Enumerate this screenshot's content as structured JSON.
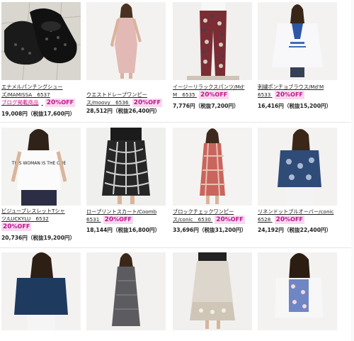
{
  "discount_suffix": "%OFF",
  "colors": {
    "accent": "#c0148c",
    "badge_bg": "#f7d9ef"
  },
  "products": [
    {
      "name_line1": "エナメルパンチングシュー",
      "name_line2": "ズ/MAMISSA　6537",
      "extra_tag": "ブログ掲載商品",
      "discount": "20",
      "price": "19,008円（税抜17,600円）",
      "kind": "shoes"
    },
    {
      "name_line1": "ウエストドレープワンピー",
      "name_line2": "ス/moovy　6536",
      "discount": "20",
      "price": "28,512円（税抜26,400円）",
      "kind": "pinkdress"
    },
    {
      "name_line1": "イージーリラックスパンツ/Md'",
      "name_line2": "M　6535",
      "discount": "20",
      "price": "7,776円（税抜7,200円）",
      "kind": "pants"
    },
    {
      "name_line1": "刺繍ポンチョブラウス/Md'M",
      "name_line2": "6533",
      "discount": "20",
      "price": "16,416円（税抜15,200円）",
      "kind": "poncho"
    },
    {
      "name_line1": "ビジューブレスレットTシャ",
      "name_line2": "ツ/LUCKYLU　6532",
      "discount": "20",
      "price": "20,736円（税抜19,200円）",
      "kind": "tshirt",
      "print_text": "THIS WOMAN IS THE ONE"
    },
    {
      "name_line1": "ロープリントスカート/Coomb",
      "name_line2": "6531",
      "discount": "20",
      "price": "18,144円（税抜16,800円）",
      "kind": "skirt"
    },
    {
      "name_line1": "ブロックチェックワンピー",
      "name_line2": "ス/conic　6530",
      "discount": "20",
      "price": "33,696円（税抜31,200円）",
      "kind": "checkdress"
    },
    {
      "name_line1": "リネンドットプルオーバー/conic",
      "name_line2": "6528",
      "discount": "20",
      "price": "24,192円（税抜22,400円）",
      "kind": "navytop"
    },
    {
      "name_line1": "",
      "name_line2": "",
      "discount": "",
      "price": "",
      "kind": "navyblouse"
    },
    {
      "name_line1": "",
      "name_line2": "",
      "discount": "",
      "price": "",
      "kind": "greydress"
    },
    {
      "name_line1": "",
      "name_line2": "",
      "discount": "",
      "price": "",
      "kind": "beigeskirt"
    },
    {
      "name_line1": "",
      "name_line2": "",
      "discount": "",
      "price": "",
      "kind": "floralcardigan"
    }
  ]
}
